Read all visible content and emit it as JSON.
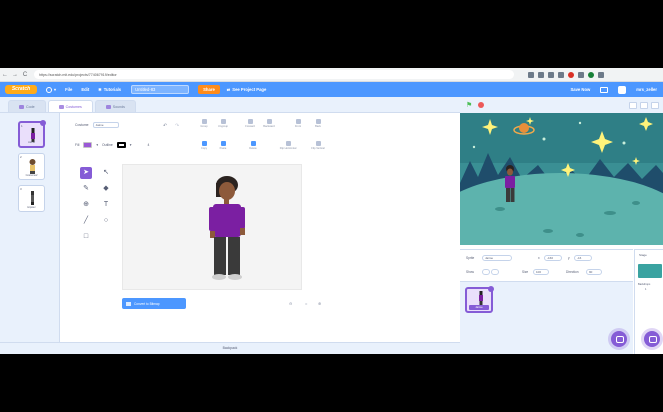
{
  "browser": {
    "url": "https://scratch.mit.edu/projects/774067919/editor",
    "back": "←",
    "forward": "→",
    "reload": "C"
  },
  "menubar": {
    "logo": "Scratch",
    "file": "File",
    "edit": "Edit",
    "tutorials": "Tutorials",
    "project_title": "Untitled-83",
    "share": "Share",
    "see_project_page": "See Project Page",
    "save_now": "Save Now",
    "username": "mrs_zeller"
  },
  "tabs": {
    "code": "Code",
    "costumes": "Costumes",
    "sounds": "Sounds"
  },
  "costume_list": [
    {
      "num": "1",
      "name": "Jaime",
      "size": "",
      "active": true
    },
    {
      "num": "2",
      "name": "Costume2",
      "size": "",
      "active": false
    },
    {
      "num": "3",
      "name": "Hipster",
      "size": "",
      "active": false
    }
  ],
  "paint": {
    "costume_label": "Costume",
    "costume_name": "Jaime",
    "fill_label": "Fill",
    "outline_label": "Outline",
    "outline_width": "4",
    "group": "Group",
    "ungroup": "Ungroup",
    "forward": "Forward",
    "backward": "Backward",
    "front": "Front",
    "back": "Back",
    "copy": "Copy",
    "paste": "Paste",
    "delete": "Delete",
    "flip_h": "Flip Horizontal",
    "flip_v": "Flip Vertical",
    "convert": "Convert to Bitmap",
    "zoom_out": "⊖",
    "zoom_reset": "=",
    "zoom_in": "⊕",
    "colors": {
      "fill": "#9b59d6",
      "outline": "#000000"
    }
  },
  "tools": {
    "select": "➤",
    "reshape": "↖",
    "brush": "✎",
    "eraser": "◆",
    "fill": "⊕",
    "text": "T",
    "line": "╱",
    "circle": "○",
    "rect": "□"
  },
  "backpack": "Backpack",
  "sprite_info": {
    "sprite_label": "Sprite",
    "sprite_name": "Jaime",
    "x_label": "x",
    "x_value": "-160",
    "y_label": "y",
    "y_value": "-16",
    "show_label": "Show",
    "size_label": "Size",
    "size_value": "100",
    "direction_label": "Direction",
    "direction_value": "90"
  },
  "sprite_tile": {
    "name": "Jaime"
  },
  "stage_target": {
    "label": "Stage",
    "backdrops_label": "Backdrops",
    "backdrops_count": "1"
  },
  "colors": {
    "scratch_blue": "#4c97ff",
    "purple": "#855cd6",
    "orange": "#ff8c1a",
    "bg_light": "#e9f1fc"
  }
}
